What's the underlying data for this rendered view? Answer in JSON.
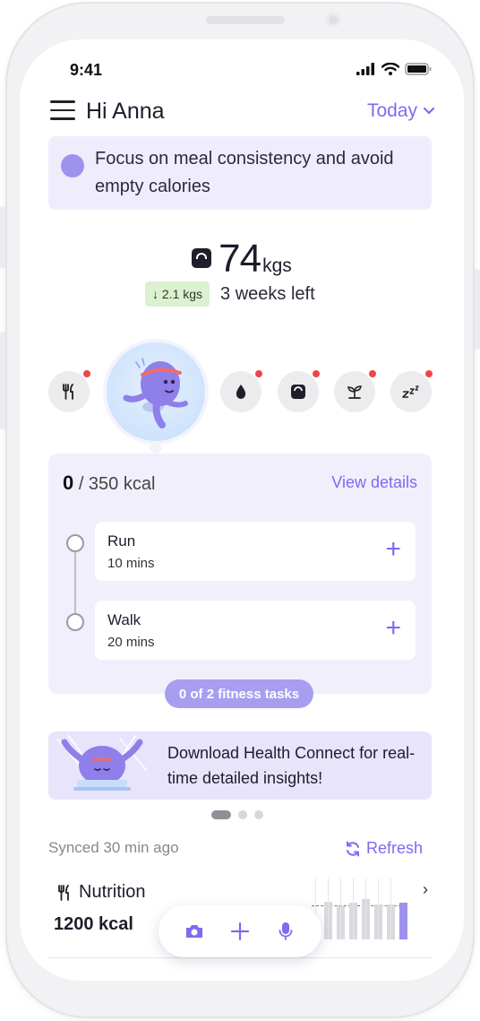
{
  "status_bar": {
    "time": "9:41"
  },
  "header": {
    "greeting": "Hi Anna",
    "date_filter": "Today"
  },
  "tip": {
    "text": "Focus on meal consistency and avoid empty calories"
  },
  "weight": {
    "value": "74",
    "unit": "kgs",
    "delta": "2.1 kgs",
    "remaining": "3 weeks left"
  },
  "trackers": [
    "fork-knife-icon",
    "run-avatar",
    "water-drop-icon",
    "scale-icon",
    "plant-icon",
    "sleep-icon"
  ],
  "fitness": {
    "kcal_current": "0",
    "kcal_goal": "/ 350 kcal",
    "view_details": "View details",
    "tasks": [
      {
        "name": "Run",
        "duration": "10 mins"
      },
      {
        "name": "Walk",
        "duration": "20 mins"
      }
    ],
    "summary": "0 of 2 fitness tasks"
  },
  "promo": {
    "text": "Download Health Connect for real-time detailed insights!"
  },
  "sync": {
    "status": "Synced 30 min ago",
    "refresh": "Refresh"
  },
  "nutrition": {
    "title": "Nutrition",
    "kcal": "1200 kcal",
    "chart_levels": [
      0.62,
      0.55,
      0.6,
      0.66,
      0.58,
      0.57,
      0.6
    ]
  },
  "colors": {
    "accent": "#7b6cf0",
    "accent_light": "#efedfc",
    "badge_red": "#ef4646",
    "success_bg": "#dcf1cf"
  }
}
